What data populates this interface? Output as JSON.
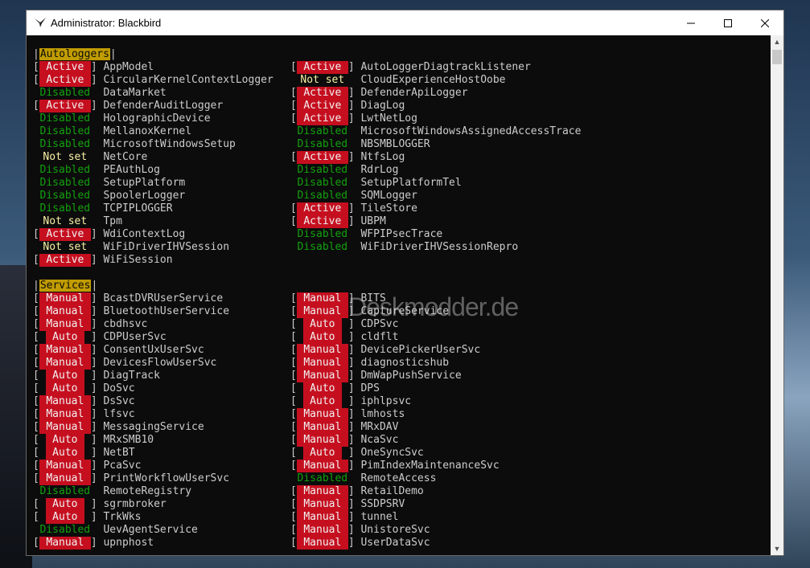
{
  "window": {
    "title": "Administrator:  Blackbird"
  },
  "colors": {
    "active_bg": "#c50f1f",
    "disabled": "#13a10e",
    "notset": "#f9f1a5",
    "header_bg": "#c19c00"
  },
  "autologgers": {
    "header": "Autologgers",
    "left": [
      {
        "status": "Active",
        "name": "AppModel"
      },
      {
        "status": "Active",
        "name": "CircularKernelContextLogger"
      },
      {
        "status": "Disabled",
        "name": "DataMarket"
      },
      {
        "status": "Active",
        "name": "DefenderAuditLogger"
      },
      {
        "status": "Disabled",
        "name": "HolographicDevice"
      },
      {
        "status": "Disabled",
        "name": "MellanoxKernel"
      },
      {
        "status": "Disabled",
        "name": "MicrosoftWindowsSetup"
      },
      {
        "status": "Not set",
        "name": "NetCore"
      },
      {
        "status": "Disabled",
        "name": "PEAuthLog"
      },
      {
        "status": "Disabled",
        "name": "SetupPlatform"
      },
      {
        "status": "Disabled",
        "name": "SpoolerLogger"
      },
      {
        "status": "Disabled",
        "name": "TCPIPLOGGER"
      },
      {
        "status": "Not set",
        "name": "Tpm"
      },
      {
        "status": "Active",
        "name": "WdiContextLog"
      },
      {
        "status": "Not set",
        "name": "WiFiDriverIHVSession"
      },
      {
        "status": "Active",
        "name": "WiFiSession"
      }
    ],
    "right": [
      {
        "status": "Active",
        "name": "AutoLoggerDiagtrackListener"
      },
      {
        "status": "Not set",
        "name": "CloudExperienceHostOobe"
      },
      {
        "status": "Active",
        "name": "DefenderApiLogger"
      },
      {
        "status": "Active",
        "name": "DiagLog"
      },
      {
        "status": "Active",
        "name": "LwtNetLog"
      },
      {
        "status": "Disabled",
        "name": "MicrosoftWindowsAssignedAccessTrace"
      },
      {
        "status": "Disabled",
        "name": "NBSMBLOGGER"
      },
      {
        "status": "Active",
        "name": "NtfsLog"
      },
      {
        "status": "Disabled",
        "name": "RdrLog"
      },
      {
        "status": "Disabled",
        "name": "SetupPlatformTel"
      },
      {
        "status": "Disabled",
        "name": "SQMLogger"
      },
      {
        "status": "Active",
        "name": "TileStore"
      },
      {
        "status": "Active",
        "name": "UBPM"
      },
      {
        "status": "Disabled",
        "name": "WFPIPsecTrace"
      },
      {
        "status": "Disabled",
        "name": "WiFiDriverIHVSessionRepro"
      }
    ]
  },
  "services": {
    "header": "Services",
    "left": [
      {
        "status": "Manual",
        "name": "BcastDVRUserService"
      },
      {
        "status": "Manual",
        "name": "BluetoothUserService"
      },
      {
        "status": "Manual",
        "name": "cbdhsvc"
      },
      {
        "status": "Auto",
        "name": "CDPUserSvc"
      },
      {
        "status": "Manual",
        "name": "ConsentUxUserSvc"
      },
      {
        "status": "Manual",
        "name": "DevicesFlowUserSvc"
      },
      {
        "status": "Auto",
        "name": "DiagTrack"
      },
      {
        "status": "Auto",
        "name": "DoSvc"
      },
      {
        "status": "Manual",
        "name": "DsSvc"
      },
      {
        "status": "Manual",
        "name": "lfsvc"
      },
      {
        "status": "Manual",
        "name": "MessagingService"
      },
      {
        "status": "Auto",
        "name": "MRxSMB10"
      },
      {
        "status": "Auto",
        "name": "NetBT"
      },
      {
        "status": "Manual",
        "name": "PcaSvc"
      },
      {
        "status": "Manual",
        "name": "PrintWorkflowUserSvc"
      },
      {
        "status": "Disabled",
        "name": "RemoteRegistry"
      },
      {
        "status": "Auto",
        "name": "sgrmbroker"
      },
      {
        "status": "Auto",
        "name": "TrkWks"
      },
      {
        "status": "Disabled",
        "name": "UevAgentService"
      },
      {
        "status": "Manual",
        "name": "upnphost"
      }
    ],
    "right": [
      {
        "status": "Manual",
        "name": "BITS"
      },
      {
        "status": "Manual",
        "name": "CaptureService"
      },
      {
        "status": "Auto",
        "name": "CDPSvc"
      },
      {
        "status": "Auto",
        "name": "cldflt"
      },
      {
        "status": "Manual",
        "name": "DevicePickerUserSvc"
      },
      {
        "status": "Manual",
        "name": "diagnosticshub"
      },
      {
        "status": "Manual",
        "name": "DmWapPushService"
      },
      {
        "status": "Auto",
        "name": "DPS"
      },
      {
        "status": "Auto",
        "name": "iphlpsvc"
      },
      {
        "status": "Manual",
        "name": "lmhosts"
      },
      {
        "status": "Manual",
        "name": "MRxDAV"
      },
      {
        "status": "Manual",
        "name": "NcaSvc"
      },
      {
        "status": "Auto",
        "name": "OneSyncSvc"
      },
      {
        "status": "Manual",
        "name": "PimIndexMaintenanceSvc"
      },
      {
        "status": "Disabled",
        "name": "RemoteAccess"
      },
      {
        "status": "Manual",
        "name": "RetailDemo"
      },
      {
        "status": "Manual",
        "name": "SSDPSRV"
      },
      {
        "status": "Manual",
        "name": "tunnel"
      },
      {
        "status": "Manual",
        "name": "UnistoreSvc"
      },
      {
        "status": "Manual",
        "name": "UserDataSvc"
      }
    ]
  },
  "watermark": "Deskmodder.de"
}
